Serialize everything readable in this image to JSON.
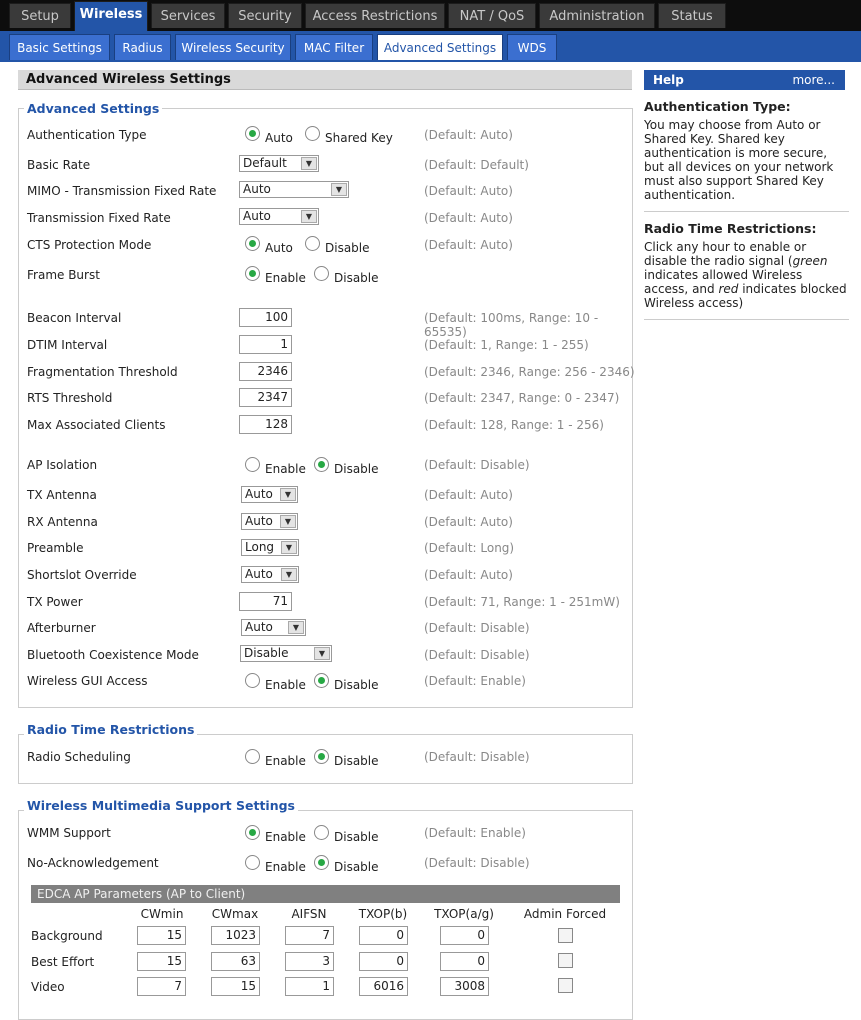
{
  "top_tabs": [
    "Setup",
    "Wireless",
    "Services",
    "Security",
    "Access Restrictions",
    "NAT / QoS",
    "Administration",
    "Status"
  ],
  "sub_tabs": [
    "Basic Settings",
    "Radius",
    "Wireless Security",
    "MAC Filter",
    "Advanced Settings",
    "WDS"
  ],
  "page_title": "Advanced Wireless Settings",
  "help": {
    "title": "Help",
    "more": "more...",
    "auth_title": "Authentication Type:",
    "auth_text": "You may choose from Auto or Shared Key. Shared key authentication is more secure, but all devices on your network must also support Shared Key authentication.",
    "radio_title": "Radio Time Restrictions:",
    "radio_text_1": "Click any hour to enable or disable the radio signal (",
    "radio_green": "green",
    "radio_text_2": " indicates allowed Wireless access, and ",
    "radio_red": "red",
    "radio_text_3": " indicates blocked Wireless access)"
  },
  "adv": {
    "legend": "Advanced Settings",
    "auth_type": {
      "label": "Authentication Type",
      "opt1": "Auto",
      "opt2": "Shared Key",
      "default": "(Default: Auto)"
    },
    "basic_rate": {
      "label": "Basic Rate",
      "value": "Default",
      "default": "(Default: Default)"
    },
    "mimo_rate": {
      "label": "MIMO - Transmission Fixed Rate",
      "value": "Auto",
      "default": "(Default: Auto)"
    },
    "tx_rate": {
      "label": "Transmission Fixed Rate",
      "value": "Auto",
      "default": "(Default: Auto)"
    },
    "cts": {
      "label": "CTS Protection Mode",
      "opt1": "Auto",
      "opt2": "Disable",
      "default": "(Default: Auto)"
    },
    "frame_burst": {
      "label": "Frame Burst",
      "opt1": "Enable",
      "opt2": "Disable"
    },
    "beacon": {
      "label": "Beacon Interval",
      "value": "100",
      "default": "(Default: 100ms, Range: 10 - 65535)"
    },
    "dtim": {
      "label": "DTIM Interval",
      "value": "1",
      "default": "(Default: 1, Range: 1 - 255)"
    },
    "frag": {
      "label": "Fragmentation Threshold",
      "value": "2346",
      "default": "(Default: 2346, Range: 256 - 2346)"
    },
    "rts": {
      "label": "RTS Threshold",
      "value": "2347",
      "default": "(Default: 2347, Range: 0 - 2347)"
    },
    "max_clients": {
      "label": "Max Associated Clients",
      "value": "128",
      "default": "(Default: 128, Range: 1 - 256)"
    },
    "ap_isolation": {
      "label": "AP Isolation",
      "opt1": "Enable",
      "opt2": "Disable",
      "default": "(Default: Disable)"
    },
    "tx_antenna": {
      "label": "TX Antenna",
      "value": "Auto",
      "default": "(Default: Auto)"
    },
    "rx_antenna": {
      "label": "RX Antenna",
      "value": "Auto",
      "default": "(Default: Auto)"
    },
    "preamble": {
      "label": "Preamble",
      "value": "Long",
      "default": "(Default: Long)"
    },
    "shortslot": {
      "label": "Shortslot Override",
      "value": "Auto",
      "default": "(Default: Auto)"
    },
    "tx_power": {
      "label": "TX Power",
      "value": "71",
      "default": "(Default: 71, Range: 1 - 251mW)"
    },
    "afterburner": {
      "label": "Afterburner",
      "value": "Auto",
      "default": "(Default: Disable)"
    },
    "bluetooth": {
      "label": "Bluetooth Coexistence Mode",
      "value": "Disable",
      "default": "(Default: Disable)"
    },
    "gui_access": {
      "label": "Wireless GUI Access",
      "opt1": "Enable",
      "opt2": "Disable",
      "default": "(Default: Enable)"
    }
  },
  "radio_time": {
    "legend": "Radio Time Restrictions",
    "label": "Radio Scheduling",
    "opt1": "Enable",
    "opt2": "Disable",
    "default": "(Default: Disable)"
  },
  "wmm": {
    "legend": "Wireless Multimedia Support Settings",
    "support": {
      "label": "WMM Support",
      "opt1": "Enable",
      "opt2": "Disable",
      "default": "(Default: Enable)"
    },
    "noack": {
      "label": "No-Acknowledgement",
      "opt1": "Enable",
      "opt2": "Disable",
      "default": "(Default: Disable)"
    },
    "edca_title": "EDCA AP Parameters (AP to Client)",
    "columns": [
      "CWmin",
      "CWmax",
      "AIFSN",
      "TXOP(b)",
      "TXOP(a/g)",
      "Admin Forced"
    ],
    "rows": [
      {
        "name": "Background",
        "cwmin": "15",
        "cwmax": "1023",
        "aifsn": "7",
        "txop_b": "0",
        "txop_ag": "0"
      },
      {
        "name": "Best Effort",
        "cwmin": "15",
        "cwmax": "63",
        "aifsn": "3",
        "txop_b": "0",
        "txop_ag": "0"
      },
      {
        "name": "Video",
        "cwmin": "7",
        "cwmax": "15",
        "aifsn": "1",
        "txop_b": "6016",
        "txop_ag": "3008"
      }
    ]
  }
}
